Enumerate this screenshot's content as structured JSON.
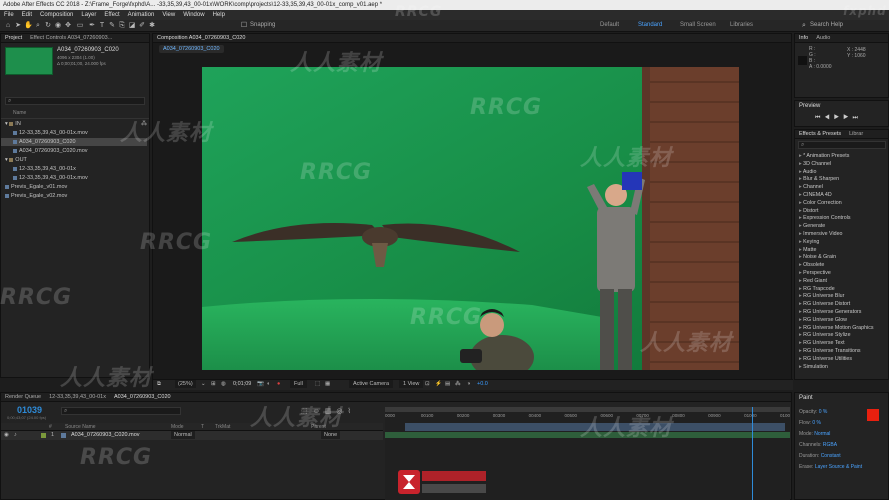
{
  "app": {
    "title": "Adobe After Effects CC 2018 - Z:\\Frame_Forge\\fxphd\\A... -33,35,39,43_00-01x\\WORK\\comp\\projects\\12-33,35,39,43_00-01x_comp_v01.aep *"
  },
  "menu": [
    "File",
    "Edit",
    "Composition",
    "Layer",
    "Effect",
    "Animation",
    "View",
    "Window",
    "Help"
  ],
  "toolbar": {
    "snapping_label": "Snapping",
    "workspaces": [
      "Default",
      "Standard",
      "Small Screen",
      "Libraries"
    ],
    "active_workspace": "Standard",
    "search_placeholder": "Search Help"
  },
  "project": {
    "tabs": [
      "Project",
      "Effect Controls A034_07260903..."
    ],
    "selected_name": "A034_07260903_C020",
    "selected_info": [
      "4096 x 2304 (1.00)",
      "Δ 0;00;01;00, 24.000 fps"
    ],
    "search_placeholder": "",
    "column_name": "Name",
    "items": [
      {
        "label": "IN",
        "kind": "folder",
        "depth": 0,
        "selected": false
      },
      {
        "label": "12-33,35,39,43_00-01x.mov",
        "kind": "footage",
        "depth": 1,
        "selected": false
      },
      {
        "label": "A034_07260903_C020",
        "kind": "comp",
        "depth": 1,
        "selected": true
      },
      {
        "label": "A034_07260903_C020.mov",
        "kind": "footage",
        "depth": 1,
        "selected": false
      },
      {
        "label": "OUT",
        "kind": "folder",
        "depth": 0,
        "selected": false
      },
      {
        "label": "12-33,35,39,43_00-01x",
        "kind": "comp",
        "depth": 1,
        "selected": false
      },
      {
        "label": "12-33,35,39,43_00-01x.mov",
        "kind": "footage",
        "depth": 1,
        "selected": false
      },
      {
        "label": "Previs_Egale_v01.mov",
        "kind": "footage",
        "depth": 0,
        "selected": false
      },
      {
        "label": "Previs_Egale_v02.mov",
        "kind": "footage",
        "depth": 0,
        "selected": false
      }
    ]
  },
  "composition": {
    "tab_label": "Composition A034_07260903_C020",
    "breadcrumb": "A034_07260903_C020",
    "zoom": "(25%)",
    "timecode": "0;01;09",
    "resolution": "Full",
    "camera": "Active Camera",
    "views": "1 View",
    "exposure": "+0.0"
  },
  "info": {
    "tabs": [
      "Info",
      "Audio"
    ],
    "values": [
      "R :",
      "G :",
      "B :",
      "A : 0",
      "X : 2448",
      "Y : 1060"
    ],
    "alpha": "A : 0.0000"
  },
  "preview": {
    "title": "Preview"
  },
  "effects": {
    "tab_label": "Effects & Presets",
    "tab2_label": "Librar",
    "search_placeholder": "",
    "items": [
      "* Animation Presets",
      "3D Channel",
      "Audio",
      "Blur & Sharpen",
      "Channel",
      "CINEMA 4D",
      "Color Correction",
      "Distort",
      "Expression Controls",
      "Generate",
      "Immersive Video",
      "Keying",
      "Matte",
      "Noise & Grain",
      "Obsolete",
      "Perspective",
      "Red Giant",
      "RG Trapcode",
      "RG Universe Blur",
      "RG Universe Distort",
      "RG Universe Generators",
      "RG Universe Glow",
      "RG Universe Motion Graphics",
      "RG Universe Stylize",
      "RG Universe Text",
      "RG Universe Transitions",
      "RG Universe Utilities",
      "Simulation"
    ]
  },
  "timeline": {
    "tabs": [
      "Render Queue",
      "12-33,35,39,43_00-01x",
      "A034_07260903_C020"
    ],
    "current_time": "01039",
    "time_sub": "0;00;43;07 (24.00 fps)",
    "columns": [
      "#",
      "Source Name",
      "Mode",
      "T",
      "TrkMat",
      "Parent"
    ],
    "layer": {
      "number": "1",
      "name": "A034_07260903_C020.mov",
      "mode": "Normal",
      "parent": "None"
    },
    "ruler": [
      "0000",
      "00100",
      "00200",
      "00300",
      "00400",
      "00500",
      "00600",
      "00700",
      "00800",
      "00900",
      "01000",
      "0100"
    ]
  },
  "paint": {
    "title": "Paint",
    "rows": [
      "Opacity:",
      "Flow:",
      "Mode:",
      "Channels:",
      "Duration:",
      "Erase:"
    ],
    "values": [
      "0 %",
      "0 %",
      "Normal",
      "RGBA",
      "Constant",
      "Layer Source & Paint"
    ],
    "foreground_color": "#e8200f",
    "background_color": "#ffffff"
  },
  "watermarks": [
    "RRCG",
    "人人素材",
    "fxphd",
    "RRCG",
    "人人素材"
  ],
  "colors": {
    "accent_blue": "#2e8bd8",
    "greenscreen": "#1c9a4a",
    "panel_bg": "#232323"
  }
}
